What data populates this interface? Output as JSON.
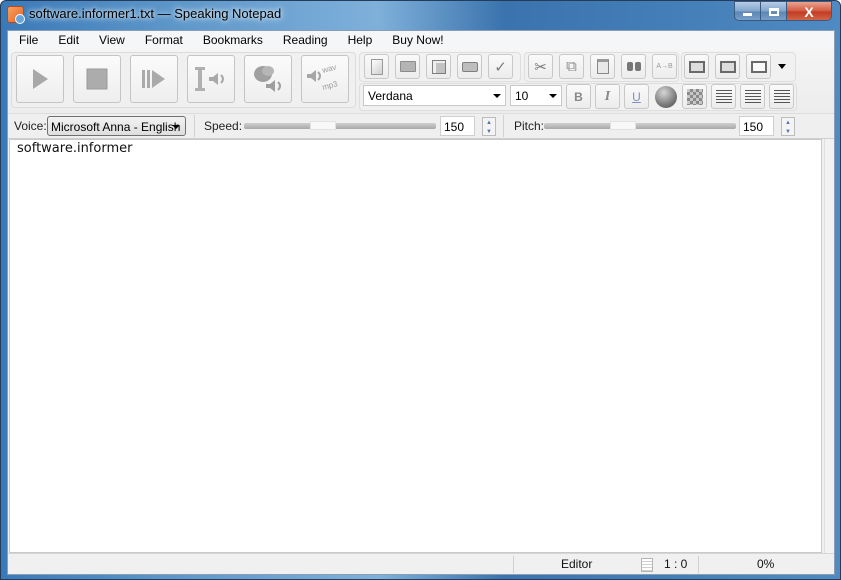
{
  "window": {
    "title": "software.informer1.txt — Speaking Notepad",
    "controls": {
      "minimize": "—",
      "maximize": "□",
      "close": "X"
    }
  },
  "menu": [
    "File",
    "Edit",
    "View",
    "Format",
    "Bookmarks",
    "Reading",
    "Help",
    "Buy Now!"
  ],
  "reading_toolbar": [
    {
      "name": "play",
      "icon": "play-icon"
    },
    {
      "name": "stop",
      "icon": "stop-icon"
    },
    {
      "name": "pause-resume",
      "icon": "pause-play-icon"
    },
    {
      "name": "read-from-cursor",
      "icon": "cursor-speaker-icon"
    },
    {
      "name": "read-clipboard",
      "icon": "clipboard-speaker-icon"
    },
    {
      "name": "save-audio",
      "icon": "wav-mp3-icon"
    }
  ],
  "file_toolbar": [
    {
      "name": "new",
      "icon": "new-document-icon",
      "glyph": "🗋"
    },
    {
      "name": "open",
      "icon": "open-folder-icon",
      "glyph": "🗁"
    },
    {
      "name": "save",
      "icon": "floppy-icon",
      "glyph": "💾"
    },
    {
      "name": "print",
      "icon": "printer-icon",
      "glyph": "⎙"
    },
    {
      "name": "spellcheck",
      "icon": "spellcheck-icon",
      "glyph": "✓"
    }
  ],
  "edit_toolbar": [
    {
      "name": "cut",
      "icon": "scissors-icon",
      "glyph": "✂"
    },
    {
      "name": "copy",
      "icon": "copy-icon",
      "glyph": "⧉"
    },
    {
      "name": "paste",
      "icon": "paste-icon",
      "glyph": "📋"
    },
    {
      "name": "find",
      "icon": "binoculars-icon",
      "glyph": "👓"
    },
    {
      "name": "replace",
      "icon": "replace-icon",
      "glyph": "A→B"
    }
  ],
  "bookmark_toolbar": [
    {
      "name": "add-bookmark",
      "icon": "add-bookmark-icon",
      "glyph": "⎘"
    },
    {
      "name": "goto-bookmark",
      "icon": "goto-bookmark-icon",
      "glyph": "⎗"
    },
    {
      "name": "bookmarks-list",
      "icon": "bookmarks-list-icon",
      "glyph": "⎙"
    }
  ],
  "format": {
    "font": "Verdana",
    "size": "10",
    "bold": "B",
    "italic": "I",
    "underline": "U"
  },
  "voice": {
    "label": "Voice:",
    "value": "Microsoft Anna - English"
  },
  "speed": {
    "label": "Speed:",
    "value": "150",
    "slider_fraction": 0.4
  },
  "pitch": {
    "label": "Pitch:",
    "value": "150",
    "slider_fraction": 0.4
  },
  "editor": {
    "content": "software.informer"
  },
  "status": {
    "mode": "Editor",
    "position": "1 : 0",
    "progress": "0%"
  }
}
